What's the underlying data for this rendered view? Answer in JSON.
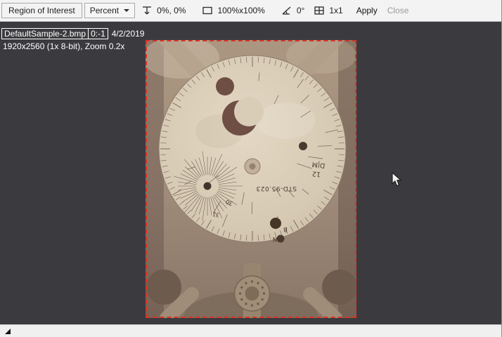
{
  "toolbar": {
    "roi_label": "Region of Interest",
    "units": "Percent",
    "position": "0%, 0%",
    "size": "100%x100%",
    "angle": "0°",
    "grid": "1x1",
    "apply": "Apply",
    "close": "Close"
  },
  "overlay": {
    "filename": "DefaultSample-2.bmp",
    "frame": "0:-1",
    "date": "4/2/2019",
    "details": "1920x2560 (1x 8-bit), Zoom 0.2x"
  },
  "specimen": {
    "labels": {
      "std": "STD-95.023",
      "dm": "D|M",
      "h12": "12",
      "jan": "JAN",
      "b": "B",
      "d31": "31",
      "d30": "30"
    }
  },
  "colors": {
    "roi_border": "#dd3126",
    "canvas_bg": "#3b3b3f",
    "toolbar_bg": "#f3f3f3"
  }
}
